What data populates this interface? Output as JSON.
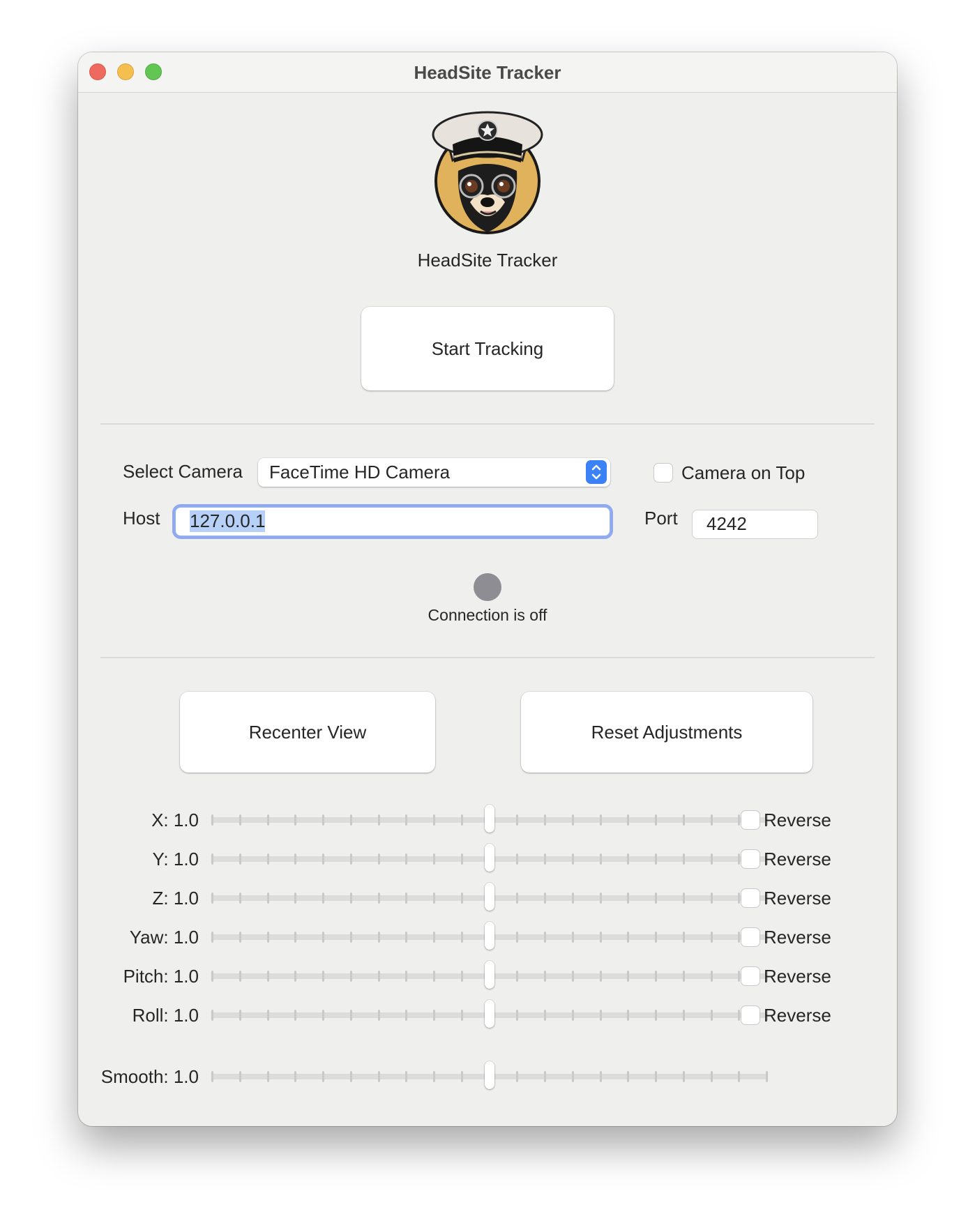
{
  "window": {
    "title": "HeadSite Tracker",
    "controls": [
      "close",
      "minimize",
      "zoom"
    ]
  },
  "header": {
    "logo_icon": "chihuahua-pilot-logo-icon",
    "app_name": "HeadSite Tracker"
  },
  "tracking": {
    "start_label": "Start Tracking"
  },
  "connection": {
    "camera_label": "Select Camera",
    "camera_value": "FaceTime HD Camera",
    "camera_on_top_label": "Camera on Top",
    "camera_on_top_checked": false,
    "host_label": "Host",
    "host_value": "127.0.0.1",
    "port_label": "Port",
    "port_value": "4242",
    "status_text": "Connection is off",
    "status_color": "#8e8d93"
  },
  "actions": {
    "recenter_label": "Recenter View",
    "reset_label": "Reset Adjustments"
  },
  "sliders": [
    {
      "label": "X: 1.0",
      "value": 0.5,
      "reverse_label": "Reverse",
      "reverse_checked": false
    },
    {
      "label": "Y: 1.0",
      "value": 0.5,
      "reverse_label": "Reverse",
      "reverse_checked": false
    },
    {
      "label": "Z: 1.0",
      "value": 0.5,
      "reverse_label": "Reverse",
      "reverse_checked": false
    },
    {
      "label": "Yaw: 1.0",
      "value": 0.5,
      "reverse_label": "Reverse",
      "reverse_checked": false
    },
    {
      "label": "Pitch: 1.0",
      "value": 0.5,
      "reverse_label": "Reverse",
      "reverse_checked": false
    },
    {
      "label": "Roll: 1.0",
      "value": 0.5,
      "reverse_label": "Reverse",
      "reverse_checked": false
    }
  ],
  "smooth": {
    "label": "Smooth: 1.0",
    "value": 0.5
  },
  "colors": {
    "accent": "#3b82f6",
    "focus_ring": "#8faaf0",
    "selection": "#b6d0f8"
  }
}
